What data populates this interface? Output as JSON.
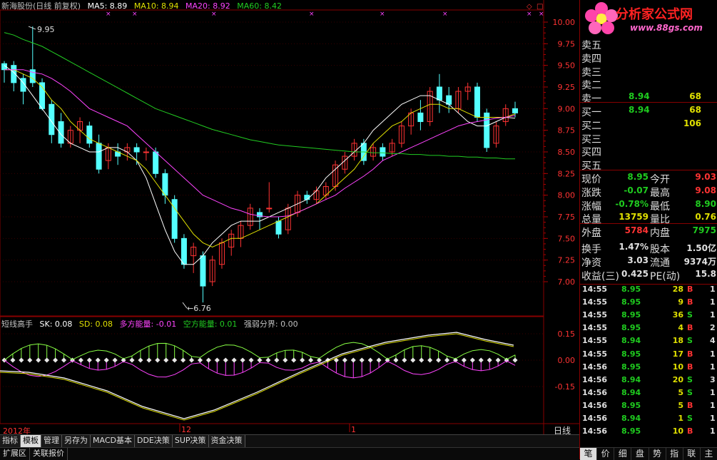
{
  "header": {
    "stock": "新海股份(日线 前复权)",
    "ma5": "MA5: 8.89",
    "ma10": "MA10: 8.94",
    "ma20": "MA20: 8.92",
    "ma60": "MA60: 8.42"
  },
  "price_axis": [
    "10.00",
    "9.75",
    "9.50",
    "9.25",
    "9.00",
    "8.75",
    "8.50",
    "8.25",
    "8.00",
    "7.75",
    "7.50",
    "7.25",
    "7.00"
  ],
  "annotations": {
    "high": "9.95",
    "low": "6.76"
  },
  "indicator": {
    "name": "短线高手",
    "sk": "SK: 0.08",
    "sd": "SD: 0.08",
    "duo": "多方能量: -0.01",
    "kong": "空方能量: 0.01",
    "qiang": "强弱分界: 0.00",
    "axis": [
      "0.15",
      "0.00",
      "-0.15"
    ]
  },
  "date_axis": {
    "left": "2012年",
    "mid1": "12",
    "mid2": "1",
    "period": "日线"
  },
  "toolbar": [
    "指标",
    "模板",
    "管理",
    "另存为",
    "MACD基本",
    "DDE决策",
    "SUP决策",
    "资金决策"
  ],
  "bottombar": [
    "扩展区",
    "关联报价"
  ],
  "logo": {
    "title": "分析家公式网",
    "url": "www.88gs.com"
  },
  "orderbook": [
    {
      "label": "卖五",
      "price": "",
      "vol": ""
    },
    {
      "label": "卖四",
      "price": "",
      "vol": ""
    },
    {
      "label": "卖三",
      "price": "",
      "vol": ""
    },
    {
      "label": "卖二",
      "price": "",
      "vol": ""
    },
    {
      "label": "卖一",
      "price": "8.94",
      "vol": "68"
    },
    {
      "label": "买一",
      "price": "8.94",
      "vol": "68"
    },
    {
      "label": "买二",
      "price": "",
      "vol": "106"
    },
    {
      "label": "买三",
      "price": "",
      "vol": ""
    },
    {
      "label": "买四",
      "price": "",
      "vol": ""
    },
    {
      "label": "买五",
      "price": "",
      "vol": ""
    }
  ],
  "quotes": [
    {
      "l1": "现价",
      "v1": "8.95",
      "c1": "#1fcc1f",
      "l2": "今开",
      "v2": "9.03",
      "c2": "#ff3333"
    },
    {
      "l1": "涨跌",
      "v1": "-0.07",
      "c1": "#1fcc1f",
      "l2": "最高",
      "v2": "9.08",
      "c2": "#ff3333"
    },
    {
      "l1": "涨幅",
      "v1": "-0.78%",
      "c1": "#1fcc1f",
      "l2": "最低",
      "v2": "8.90",
      "c2": "#1fcc1f"
    },
    {
      "l1": "总量",
      "v1": "13759",
      "c1": "#e0e000",
      "l2": "量比",
      "v2": "0.76",
      "c2": "#e0e000"
    },
    {
      "l1": "外盘",
      "v1": "5784",
      "c1": "#ff3333",
      "l2": "内盘",
      "v2": "7975",
      "c2": "#1fcc1f"
    },
    {
      "l1": "换手",
      "v1": "1.47%",
      "c1": "#e0e0e0",
      "l2": "股本",
      "v2": "1.50亿",
      "c2": "#e0e0e0"
    },
    {
      "l1": "净资",
      "v1": "3.03",
      "c1": "#e0e0e0",
      "l2": "流通",
      "v2": "9374万",
      "c2": "#e0e0e0"
    },
    {
      "l1": "收益(三)",
      "v1": "0.425",
      "c1": "#e0e0e0",
      "l2": "PE(动)",
      "v2": "15.8",
      "c2": "#e0e0e0"
    }
  ],
  "ticks": [
    {
      "time": "14:55",
      "price": "8.95",
      "vol": "28",
      "side": "B",
      "n": "1"
    },
    {
      "time": "14:55",
      "price": "8.95",
      "vol": "9",
      "side": "B",
      "n": "1"
    },
    {
      "time": "14:55",
      "price": "8.95",
      "vol": "36",
      "side": "S",
      "n": "1"
    },
    {
      "time": "14:55",
      "price": "8.95",
      "vol": "4",
      "side": "B",
      "n": "2"
    },
    {
      "time": "14:55",
      "price": "8.94",
      "vol": "18",
      "side": "S",
      "n": "4"
    },
    {
      "time": "14:55",
      "price": "8.95",
      "vol": "17",
      "side": "B",
      "n": "1"
    },
    {
      "time": "14:56",
      "price": "8.95",
      "vol": "10",
      "side": "B",
      "n": "1"
    },
    {
      "time": "14:56",
      "price": "8.94",
      "vol": "20",
      "side": "S",
      "n": "3"
    },
    {
      "time": "14:56",
      "price": "8.94",
      "vol": "5",
      "side": "S",
      "n": "1"
    },
    {
      "time": "14:56",
      "price": "8.95",
      "vol": "5",
      "side": "B",
      "n": "1"
    },
    {
      "time": "14:56",
      "price": "8.94",
      "vol": "1",
      "side": "S",
      "n": "1"
    },
    {
      "time": "14:56",
      "price": "8.95",
      "vol": "10",
      "side": "B",
      "n": "1"
    }
  ],
  "right_tabs": [
    "笔",
    "价",
    "细",
    "盘",
    "势",
    "指",
    "联",
    "主"
  ],
  "colors": {
    "up": "#ff3333",
    "down": "#1fcc1f",
    "candle_down": "#54ffff",
    "ma5": "#ffffff",
    "ma10": "#e0e000",
    "ma20": "#ff44ff",
    "ma60": "#22cc22"
  },
  "chart_data": {
    "type": "candlestick",
    "y_range": [
      6.7,
      10.1
    ],
    "series": [
      {
        "name": "MA5",
        "values": [
          9.5,
          9.42,
          9.3,
          9.15,
          9.0,
          8.85,
          8.7,
          8.6,
          8.55,
          8.5,
          8.5,
          8.55,
          8.55,
          8.5,
          8.4,
          8.2,
          7.9,
          7.6,
          7.35,
          7.2,
          7.2,
          7.3,
          7.45,
          7.55,
          7.65,
          7.7,
          7.7,
          7.7,
          7.75,
          7.8,
          7.85,
          7.9,
          7.95,
          8.05,
          8.2,
          8.3,
          8.4,
          8.5,
          8.6,
          8.75,
          8.85,
          8.95,
          9.05,
          9.1,
          9.15,
          9.15,
          9.1,
          9.05,
          8.95,
          8.85,
          8.8,
          8.8,
          8.85,
          8.9,
          8.89
        ]
      },
      {
        "name": "MA10",
        "values": [
          9.45,
          9.45,
          9.4,
          9.35,
          9.25,
          9.1,
          9.0,
          8.85,
          8.75,
          8.65,
          8.6,
          8.55,
          8.5,
          8.45,
          8.4,
          8.3,
          8.15,
          8.0,
          7.85,
          7.7,
          7.55,
          7.45,
          7.4,
          7.45,
          7.5,
          7.5,
          7.55,
          7.6,
          7.65,
          7.7,
          7.75,
          7.8,
          7.85,
          7.9,
          8.0,
          8.1,
          8.2,
          8.3,
          8.45,
          8.6,
          8.7,
          8.8,
          8.85,
          8.95,
          9.0,
          9.05,
          9.05,
          9.0,
          9.0,
          8.95,
          8.9,
          8.9,
          8.9,
          8.9,
          8.94
        ]
      },
      {
        "name": "MA20",
        "values": [
          9.45,
          9.45,
          9.45,
          9.42,
          9.4,
          9.35,
          9.28,
          9.2,
          9.1,
          9.0,
          8.95,
          8.9,
          8.85,
          8.8,
          8.7,
          8.6,
          8.5,
          8.4,
          8.3,
          8.2,
          8.1,
          8.0,
          7.95,
          7.9,
          7.85,
          7.82,
          7.78,
          7.76,
          7.75,
          7.75,
          7.76,
          7.8,
          7.85,
          7.9,
          7.95,
          8.0,
          8.08,
          8.15,
          8.22,
          8.3,
          8.4,
          8.45,
          8.5,
          8.55,
          8.6,
          8.65,
          8.7,
          8.75,
          8.8,
          8.83,
          8.85,
          8.87,
          8.89,
          8.9,
          8.92
        ]
      },
      {
        "name": "MA60",
        "values": [
          9.88,
          9.85,
          9.8,
          9.76,
          9.72,
          9.66,
          9.6,
          9.54,
          9.48,
          9.42,
          9.36,
          9.3,
          9.24,
          9.18,
          9.12,
          9.06,
          9.0,
          8.96,
          8.92,
          8.88,
          8.84,
          8.8,
          8.76,
          8.73,
          8.7,
          8.67,
          8.64,
          8.62,
          8.6,
          8.58,
          8.57,
          8.56,
          8.55,
          8.54,
          8.53,
          8.52,
          8.51,
          8.5,
          8.5,
          8.49,
          8.49,
          8.48,
          8.48,
          8.47,
          8.47,
          8.46,
          8.46,
          8.45,
          8.45,
          8.44,
          8.44,
          8.43,
          8.43,
          8.42,
          8.42
        ]
      }
    ]
  }
}
